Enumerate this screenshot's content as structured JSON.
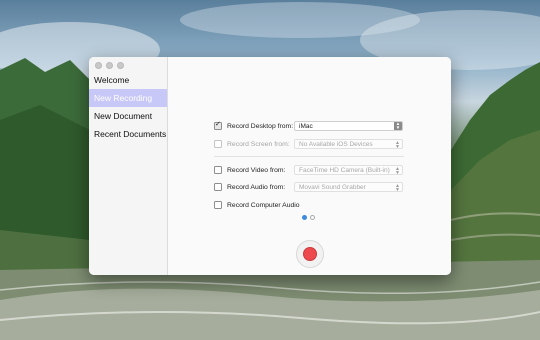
{
  "window": {
    "controls": [
      "close",
      "minimize",
      "zoom"
    ]
  },
  "sidebar": {
    "items": [
      {
        "label": "Welcome",
        "active": false
      },
      {
        "label": "New Recording",
        "active": true
      },
      {
        "label": "New Document",
        "active": false
      },
      {
        "label": "Recent Documents",
        "active": false
      }
    ]
  },
  "options": {
    "desktop": {
      "label": "Record Desktop from:",
      "checked": true,
      "enabled": true,
      "value": "iMac"
    },
    "screen": {
      "label": "Record Screen from:",
      "checked": false,
      "enabled": false,
      "value": "No Available iOS Devices"
    },
    "video": {
      "label": "Record Video from:",
      "checked": false,
      "enabled": true,
      "value": "FaceTime HD Camera (Built-in)"
    },
    "audio": {
      "label": "Record Audio from:",
      "checked": false,
      "enabled": true,
      "value": "Movavi Sound Grabber"
    },
    "computer_audio": {
      "label": "Record Computer Audio",
      "checked": false,
      "enabled": true
    }
  },
  "pager": {
    "pages": 2,
    "current": 1
  },
  "colors": {
    "accent_sidebar": "#c7c7f8",
    "record_button": "#ee4a4e",
    "pager_active": "#3d8be0"
  },
  "icons": {
    "record_button": "record-icon"
  }
}
